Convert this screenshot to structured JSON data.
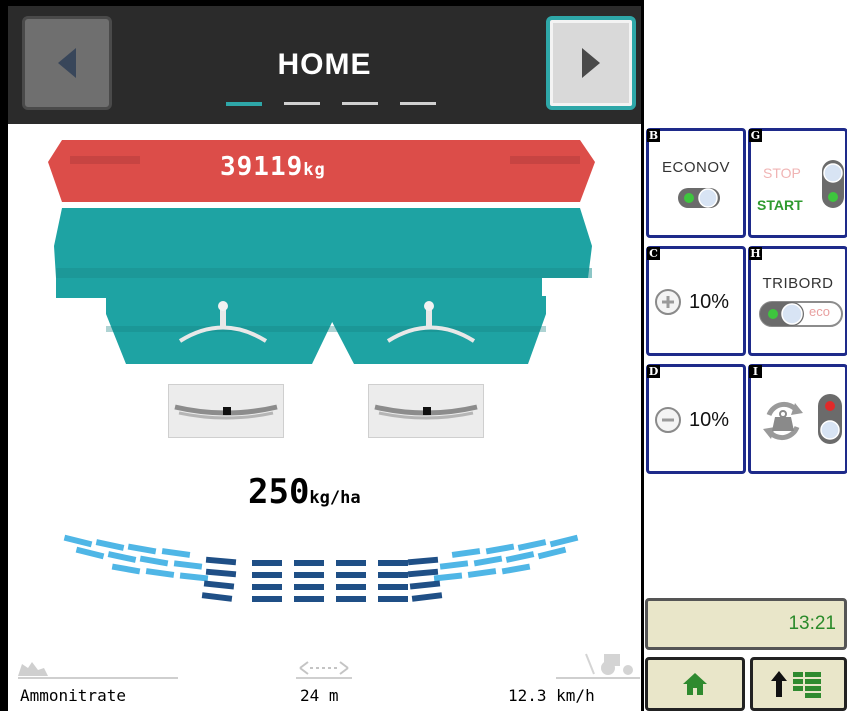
{
  "header": {
    "title": "HOME",
    "prev_icon": "arrow-left-icon",
    "next_icon": "arrow-right-icon",
    "page_count": 4,
    "active_page": 1
  },
  "hopper": {
    "weight_value": "39119",
    "weight_unit": "kg"
  },
  "application": {
    "rate_value": "250",
    "rate_unit": "kg/ha"
  },
  "footer": {
    "product": "Ammonitrate",
    "width": "24 m",
    "speed": "12.3 km/h",
    "product_icon": "fertilizer-pile-icon",
    "width_icon": "spread-width-icon",
    "speed_icon": "tractor-speed-icon"
  },
  "tiles": {
    "b": {
      "letter": "B",
      "title": "ECONOV",
      "toggle_icon": "toggle-icon"
    },
    "g": {
      "letter": "G",
      "stop_label": "STOP",
      "start_label": "START"
    },
    "c": {
      "letter": "C",
      "value": "10%",
      "icon": "plus-circle-icon"
    },
    "h": {
      "letter": "H",
      "title": "TRIBORD",
      "eco_label": "eco"
    },
    "d": {
      "letter": "D",
      "value": "10%",
      "icon": "minus-circle-icon"
    },
    "i": {
      "letter": "I",
      "icon": "weigh-cycle-icon"
    }
  },
  "status": {
    "time": "13:21"
  },
  "bottom_buttons": {
    "home_icon": "home-icon",
    "menu_icon": "up-arrow-list-icon"
  },
  "colors": {
    "hopper_red": "#dc4d49",
    "hopper_teal": "#1ea3a3",
    "tile_border": "#1e2a8a",
    "accent_cyan": "#2ea7a8",
    "clock_green": "#2a8a2a",
    "panel_beige": "#e9e6c9"
  }
}
